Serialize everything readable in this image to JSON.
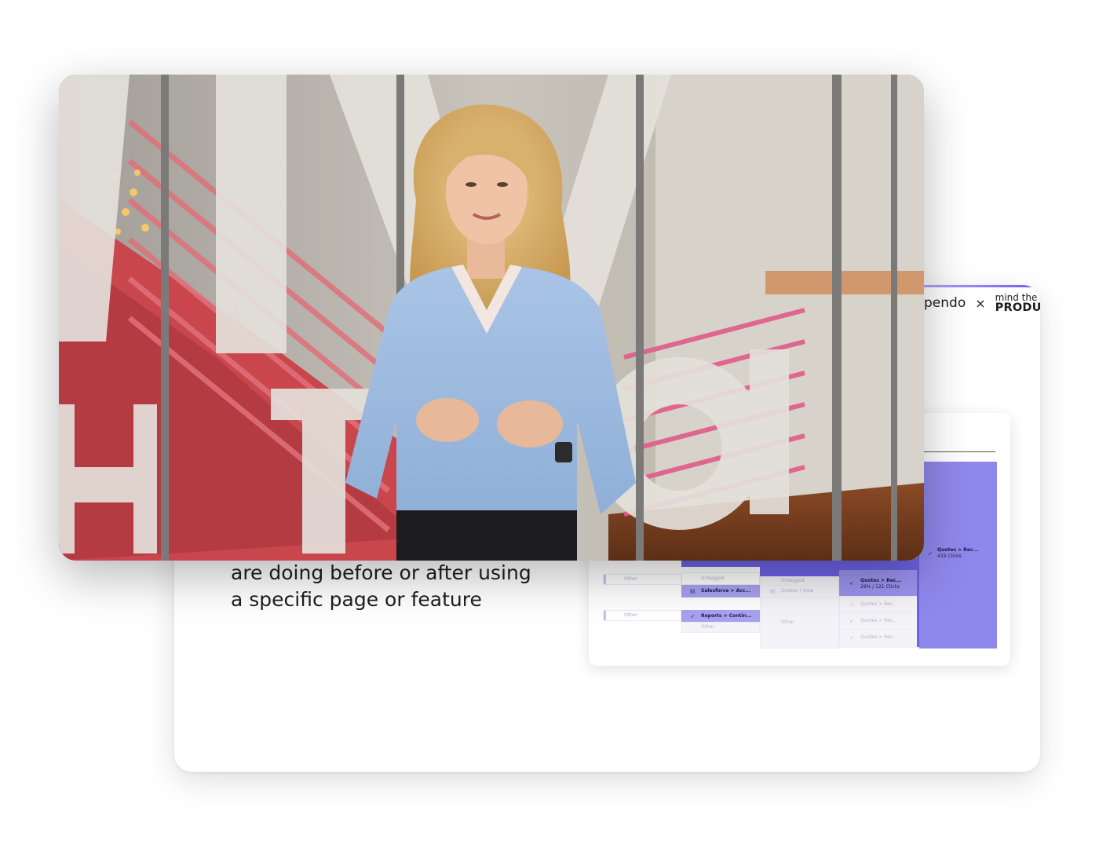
{
  "slide": {
    "brand": {
      "pendo": "pendo",
      "times": "×",
      "mtp_top": "mind the",
      "mtp_bottom": "PRODUCT"
    },
    "caption": {
      "line1": "are doing before or after using",
      "line2": "a specific page or feature"
    }
  },
  "panel": {
    "nodes": [
      {
        "label": "Other"
      },
      {
        "label": "Other"
      },
      {
        "label": "Untagged"
      },
      {
        "label": "Salesforce > Acc..."
      },
      {
        "label": "Reports > Contin..."
      },
      {
        "label": "Other"
      },
      {
        "label": "Untagged"
      },
      {
        "label": "Quotes | View"
      },
      {
        "label": "Other"
      },
      {
        "label": "Quotes > Rec..."
      },
      {
        "label": "29% / 121 Clicks"
      },
      {
        "label": "Quotes > Rec..."
      },
      {
        "label": "Quotes > Rec..."
      },
      {
        "label": "Quotes > Rec..."
      },
      {
        "label": "Quotes > Rec..."
      },
      {
        "label": "433 Clicks"
      }
    ]
  },
  "video": {
    "description": "Presenter speaking in an office lobby"
  },
  "colors": {
    "accent": "#6d63e6",
    "accent_light": "#8f88ec",
    "blouse": "#9fbde0",
    "glass_red": "#d64a55"
  }
}
